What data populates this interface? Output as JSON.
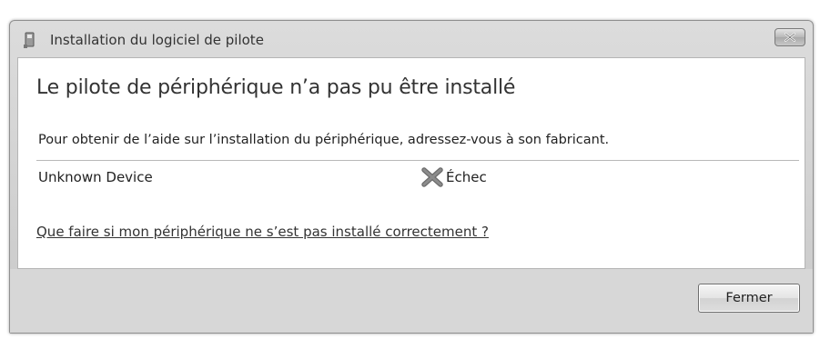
{
  "window": {
    "title": "Installation du logiciel de pilote"
  },
  "content": {
    "heading": "Le pilote de périphérique n’a pas pu être installé",
    "instructions": "Pour obtenir de l’aide sur l’installation du périphérique, adressez-vous à son fabricant.",
    "devices": [
      {
        "name": "Unknown Device",
        "status": "Échec",
        "status_icon": "error-x-icon"
      }
    ],
    "help_link": "Que faire si mon périphérique ne s’est pas installé correctement ?"
  },
  "footer": {
    "close_label": "Fermer"
  }
}
